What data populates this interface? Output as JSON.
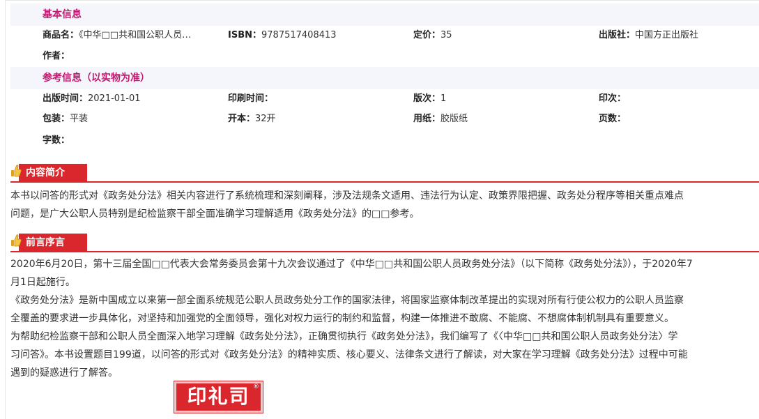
{
  "basic": {
    "heading": "基本信息",
    "name_label": "商品名：",
    "name_value": "《中华□□共和国公职人员…",
    "isbn_label": "ISBN：",
    "isbn_value": "9787517408413",
    "price_label": "定价：",
    "price_value": "35",
    "publisher_label": "出版社：",
    "publisher_value": "中国方正出版社",
    "author_label": "作者：",
    "author_value": ""
  },
  "reference": {
    "heading": "参考信息（以实物为准）",
    "pubdate_label": "出版时间：",
    "pubdate_value": "2021-01-01",
    "printdate_label": "印刷时间：",
    "printdate_value": "",
    "edition_label": "版次：",
    "edition_value": "1",
    "printing_label": "印次：",
    "printing_value": "",
    "binding_label": "包装：",
    "binding_value": "平装",
    "format_label": "开本：",
    "format_value": "32开",
    "paper_label": "用纸：",
    "paper_value": "胶版纸",
    "pages_label": "页数：",
    "pages_value": "",
    "words_label": "字数：",
    "words_value": ""
  },
  "intro": {
    "title": "内容简介",
    "line1": "本书以问答的形式对《政务处分法》相关内容进行了系统梳理和深刻阐释，涉及法规条文适用、违法行为认定、政策界限把握、政务处分程序等相关重点难点",
    "line2": "问题，是广大公职人员特别是纪检监察干部全面准确学习理解适用《政务处分法》的□□参考。"
  },
  "preface": {
    "title": "前言序言",
    "line1": "2020年6月20日，第十三届全国□□代表大会常务委员会第十九次会议通过了《中华□□共和国公职人员政务处分法》（以下简称《政务处分法》），于2020年7",
    "line2": "月1日起施行。",
    "line3": "《政务处分法》是新中国成立以来第一部全面系统规范公职人员政务处分工作的国家法律，将国家监察体制改革提出的实现对所有行使公权力的公职人员监察",
    "line4": "全覆盖的要求进一步具体化，对坚持和加强党的全面领导，强化对权力运行的制约和监督，构建一体推进不敢腐、不能腐、不想腐体制机制具有重要意义。",
    "line5": "为帮助纪检监察干部和公职人员全面深入地学习理解《政务处分法》，正确贯彻执行《政务处分法》，我们编写了《〈中华□□共和国公职人员政务处分法〉学",
    "line6": "习问答》。本书设置题目199道，以问答的形式对《政务处分法》的精神实质、核心要义、法律条文进行了解读，对大家在学习理解《政务处分法》过程中可能",
    "line7": "遇到的疑惑进行了解答。"
  },
  "stamp": {
    "text": "印礼司",
    "mark": "®"
  },
  "colors": {
    "accent_red": "#d9272d",
    "heading_magenta": "#c0196f",
    "heading_bg": "#f4f6fb"
  },
  "icons": {
    "title_icon": "thumbs-up-icon"
  }
}
